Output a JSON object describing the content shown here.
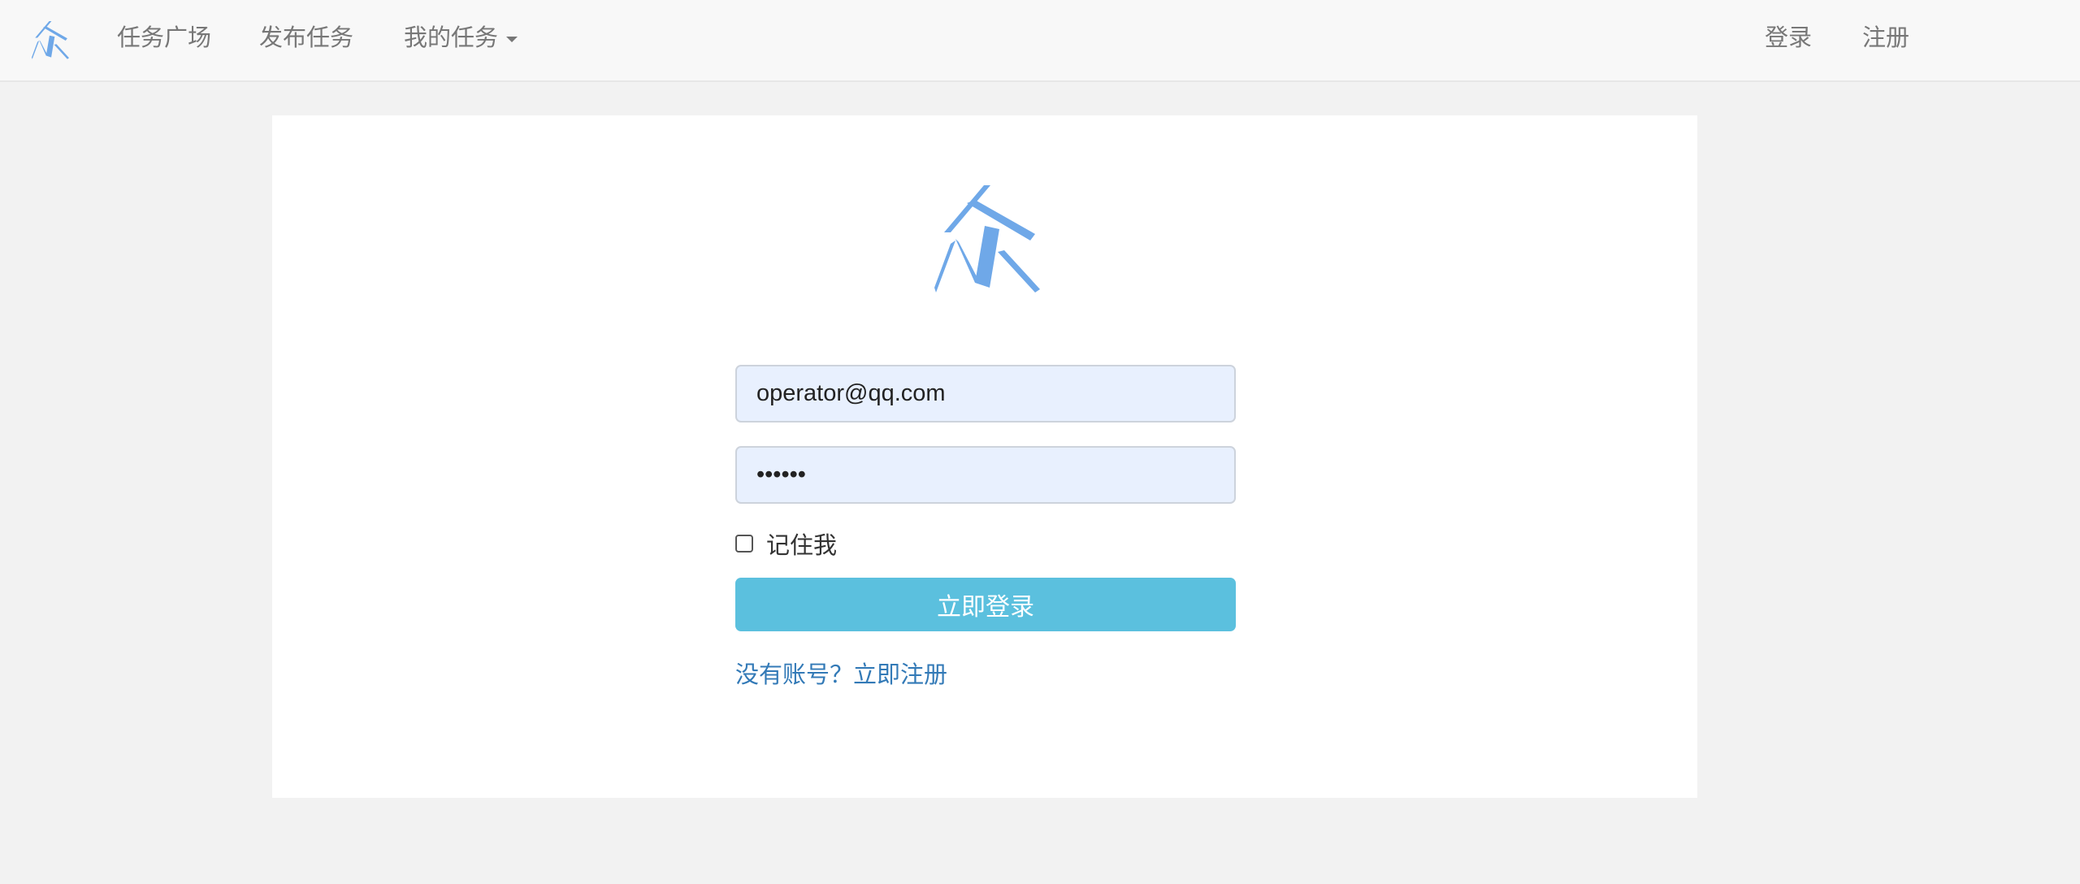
{
  "navbar": {
    "brand_icon": "zhong-logo-icon",
    "left_items": [
      "任务广场",
      "发布任务",
      "我的任务"
    ],
    "right_items": [
      "登录",
      "注册"
    ]
  },
  "login": {
    "logo_icon": "zhong-logo-icon",
    "email_value": "operator@qq.com",
    "password_value": "••••••",
    "remember_label": "记住我",
    "submit_label": "立即登录",
    "register_link": "没有账号？立即注册"
  },
  "colors": {
    "accent": "#5bc0de",
    "link": "#337ab7",
    "logo": "#6fa8e8",
    "input_autofill": "#e8f0fe"
  }
}
